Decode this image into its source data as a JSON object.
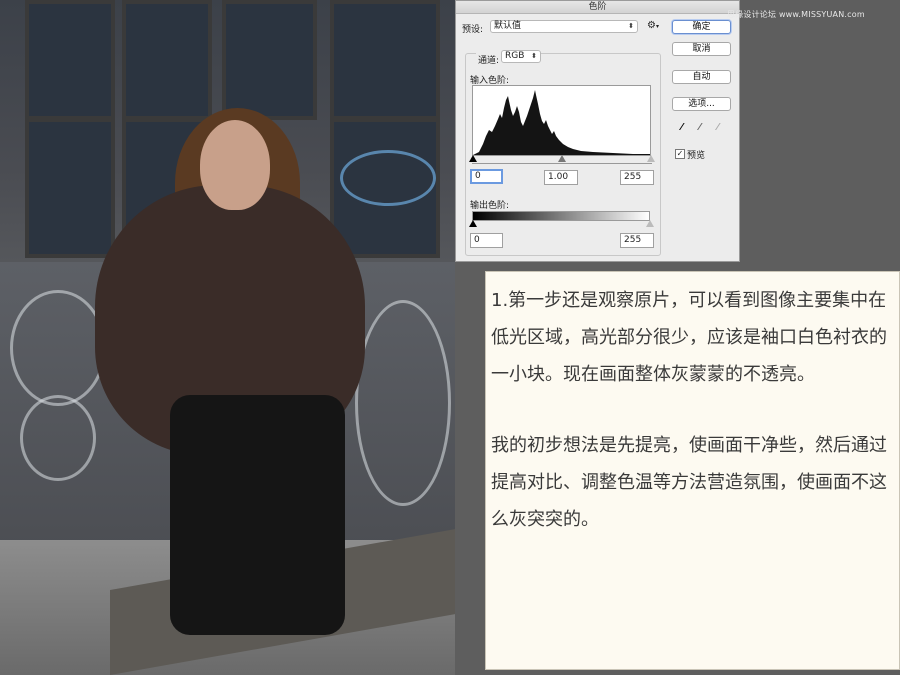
{
  "watermark": "思缘设计论坛 www.MISSYUAN.com",
  "dialog": {
    "title": "色阶",
    "preset_label": "预设:",
    "preset_value": "默认值",
    "gear_icon": "gear-icon",
    "channel_label": "通道:",
    "channel_value": "RGB",
    "input_levels_label": "输入色阶:",
    "input_black": "0",
    "input_gamma": "1.00",
    "input_white": "255",
    "output_levels_label": "输出色阶:",
    "output_black": "0",
    "output_white": "255",
    "buttons": {
      "ok": "确定",
      "cancel": "取消",
      "auto": "自动",
      "options": "选项..."
    },
    "preview_label": "预览",
    "preview_checked": true,
    "preview_check_glyph": "✓",
    "eyedroppers": [
      "black-eyedropper-icon",
      "gray-eyedropper-icon",
      "white-eyedropper-icon"
    ],
    "eyedropper_glyph": "⁄"
  },
  "note": {
    "paragraph1": "1.第一步还是观察原片，可以看到图像主要集中在低光区域，高光部分很少，应该是袖口白色衬衣的一小块。现在画面整体灰蒙蒙的不透亮。",
    "paragraph2": "我的初步想法是先提亮，使画面干净些，然后通过提高对比、调整色温等方法营造氛围，使画面不这么灰突突的。"
  },
  "colors": {
    "page_bg": "#5e5e5e",
    "note_bg": "#fdfaf1",
    "dialog_bg": "#ececec",
    "histogram_fill": "#141414"
  }
}
